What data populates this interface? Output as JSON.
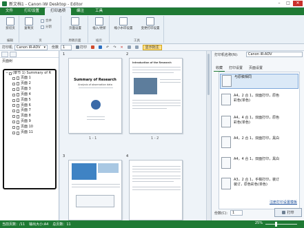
{
  "window": {
    "title": "新文档1 - Canon iW Desktop - Editor",
    "controls": {
      "minimize": "–",
      "maximize": "□",
      "close": "✕"
    }
  },
  "menu": {
    "tabs": [
      "文件",
      "打印设置",
      "打印选项",
      "编注",
      "工具"
    ],
    "active_index": 2
  },
  "ribbon": {
    "groups": [
      {
        "label": "编辑",
        "buttons": [
          "剪切页"
        ]
      },
      {
        "label": "页",
        "buttons": [
          "复制页",
          "合并",
          "分割"
        ]
      },
      {
        "label": "原稿页面",
        "buttons": [
          "页面设置"
        ]
      },
      {
        "label": "插页",
        "buttons": [
          "插入/更新"
        ]
      },
      {
        "label": "工具",
        "buttons": [
          "缩小水印设置",
          "变更打印设置"
        ]
      }
    ]
  },
  "toolbar": {
    "print_mode_label": "打印机",
    "printer_combo": "Canon iR-ADV",
    "copies_label": "份数",
    "copies_value": "1",
    "print_button": "打印",
    "show_annot_button": "显示批注"
  },
  "left_panel": {
    "title": "页面树",
    "tree_root": "(章节 1) Summary of R",
    "pages": [
      "页面 1",
      "页面 2",
      "页面 3",
      "页面 4",
      "页面 5",
      "页面 6",
      "页面 7",
      "页面 8",
      "页面 9",
      "页面 10",
      "页面 11"
    ]
  },
  "center": {
    "pages": [
      {
        "num": "1",
        "caption": "1 - 1",
        "title": "Summary of Research",
        "subtitle": "Analysis of observation data"
      },
      {
        "num": "2",
        "caption": "1 - 2",
        "title": "Introduction of the Research"
      },
      {
        "num": "3",
        "caption": "",
        "title": ""
      },
      {
        "num": "4",
        "caption": "",
        "title": ""
      }
    ]
  },
  "right_panel": {
    "printer_label": "打印机名称(N):",
    "printer_value": "Canon iR-ADV",
    "tabs": [
      "收藏",
      "打印设置",
      "页面设置"
    ],
    "presets": [
      "与原稿相同",
      "A4，2 合 1，双面打印，原色\n彩色(单色)",
      "A4，4 合 1，双面打印，原色\n彩色(单色)",
      "A4，2 合 1，双面打印，黑白",
      "A4，4 合 1，双面打印，黑白",
      "A3，2 合 1，手稿打印，装订\n装订，原色彩色(单色)"
    ],
    "link": "注册打印设置模板",
    "copies_label": "份数(C):",
    "copies_value": "1",
    "print_button": "打印"
  },
  "statusbar": {
    "items": [
      "当前页数：/11",
      "输出大小:A4",
      "总页数：11"
    ],
    "zoom": "25%"
  },
  "colors": {
    "accent": "#1f7a34",
    "highlight": "#ffe08a"
  }
}
